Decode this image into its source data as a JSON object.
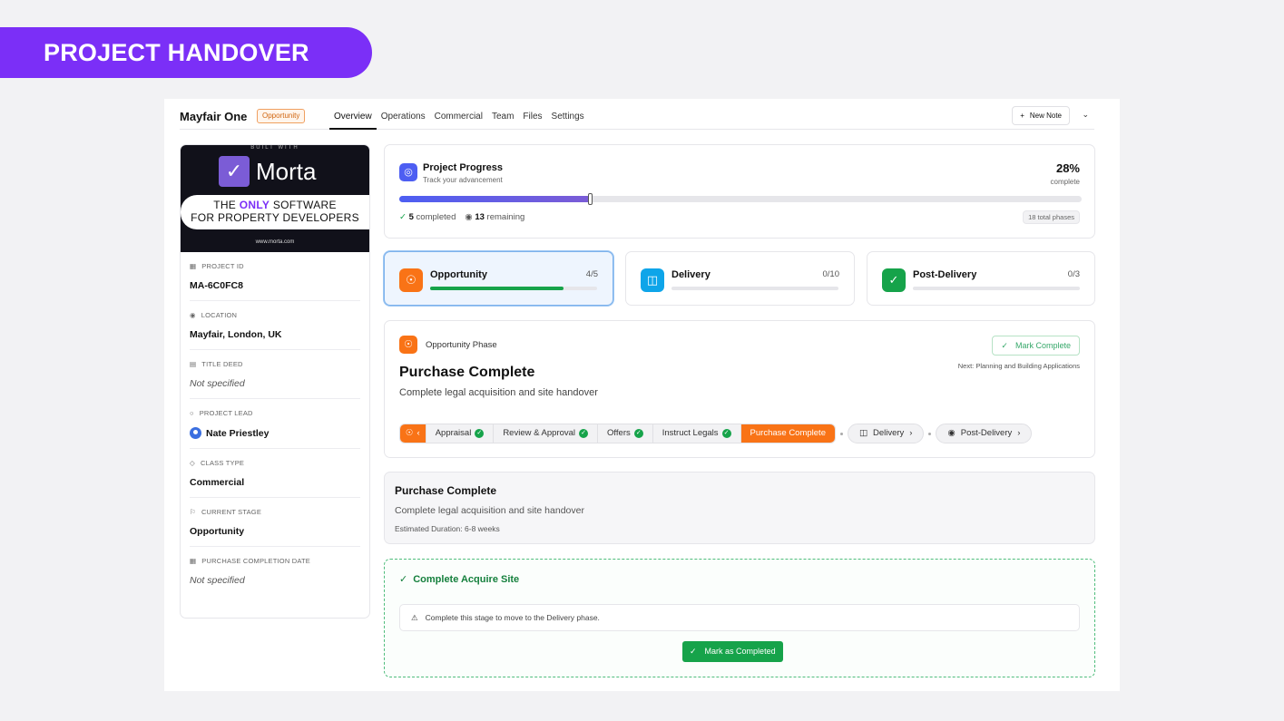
{
  "banner": {
    "title": "PROJECT HANDOVER"
  },
  "header": {
    "project_name": "Mayfair One",
    "stage_badge": "Opportunity",
    "tabs": [
      "Overview",
      "Operations",
      "Commercial",
      "Team",
      "Files",
      "Settings"
    ],
    "active_tab": "Overview",
    "new_note_label": "New Note"
  },
  "promo": {
    "built_with": "BUILT WITH",
    "logo": "Morta",
    "tagline_pre": "THE ",
    "tagline_em": "ONLY",
    "tagline_post": " SOFTWARE",
    "tagline_line2": "FOR PROPERTY DEVELOPERS",
    "url": "www.morta.com"
  },
  "sidebar": {
    "fields": [
      {
        "label": "PROJECT ID",
        "value": "MA-6C0FC8"
      },
      {
        "label": "LOCATION",
        "value": "Mayfair, London, UK"
      },
      {
        "label": "TITLE DEED",
        "value": "Not specified"
      },
      {
        "label": "PROJECT LEAD",
        "value": "Nate Priestley"
      },
      {
        "label": "CLASS TYPE",
        "value": "Commercial"
      },
      {
        "label": "CURRENT STAGE",
        "value": "Opportunity"
      },
      {
        "label": "PURCHASE COMPLETION DATE",
        "value": "Not specified"
      }
    ]
  },
  "progress": {
    "title": "Project Progress",
    "subtitle": "Track your advancement",
    "percent": "28%",
    "percent_value": 28,
    "percent_label": "complete",
    "completed_count": "5",
    "completed_label": "completed",
    "remaining_count": "13",
    "remaining_label": "remaining",
    "total_label": "18 total phases"
  },
  "phases": [
    {
      "name": "Opportunity",
      "count": "4/5",
      "fraction": 0.8,
      "color": "#f97316"
    },
    {
      "name": "Delivery",
      "count": "0/10",
      "fraction": 0,
      "color": "#0ea5e9"
    },
    {
      "name": "Post-Delivery",
      "count": "0/3",
      "fraction": 0,
      "color": "#16a34a"
    }
  ],
  "detail": {
    "phase_label": "Opportunity Phase",
    "title": "Purchase Complete",
    "subtitle": "Complete legal acquisition and site handover",
    "mark_complete_label": "Mark Complete",
    "next_label": "Next: Planning and Building Applications",
    "steps": [
      "Appraisal",
      "Review & Approval",
      "Offers",
      "Instruct Legals"
    ],
    "current_step": "Purchase Complete",
    "pills": [
      "Delivery",
      "Post-Delivery"
    ]
  },
  "info": {
    "title": "Purchase Complete",
    "subtitle": "Complete legal acquisition and site handover",
    "duration": "Estimated Duration: 6-8 weeks"
  },
  "complete": {
    "title": "Complete Acquire Site",
    "note": "Complete this stage to move to the Delivery phase.",
    "button_label": "Mark as Completed"
  }
}
